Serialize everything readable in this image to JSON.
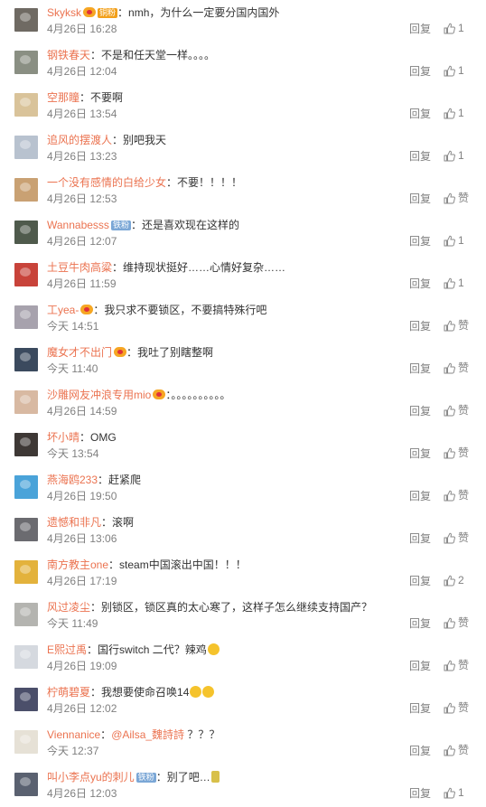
{
  "reply_label": "回复",
  "comments": [
    {
      "avatar_color": "#6f6a63",
      "name": "Skyksk",
      "badge": "",
      "vip": true,
      "medal": "铜粉",
      "colon": "：",
      "mention": "",
      "text": "nmh，为什么一定要分国内国外",
      "emoji": "",
      "time": "4月26日 16:28",
      "like": "1"
    },
    {
      "avatar_color": "#8a8f83",
      "name": "钢铁春天",
      "badge": "",
      "vip": false,
      "medal": "",
      "colon": "：",
      "mention": "",
      "text": "不是和任天堂一样。。。。",
      "emoji": "",
      "time": "4月26日 12:04",
      "like": "1"
    },
    {
      "avatar_color": "#d9c39a",
      "name": "空那瞳",
      "badge": "",
      "vip": false,
      "medal": "",
      "colon": "：",
      "mention": "",
      "text": "不要啊",
      "emoji": "",
      "time": "4月26日 13:54",
      "like": "1"
    },
    {
      "avatar_color": "#b8c2cf",
      "name": "追风的摆渡人",
      "badge": "",
      "vip": false,
      "medal": "",
      "colon": "：",
      "mention": "",
      "text": "别吧我天",
      "emoji": "",
      "time": "4月26日 13:23",
      "like": "1"
    },
    {
      "avatar_color": "#c9a173",
      "name": "一个没有感情的白给少女",
      "badge": "",
      "vip": false,
      "medal": "",
      "colon": "：",
      "mention": "",
      "text": "不要！！！！",
      "emoji": "",
      "time": "4月26日 12:53",
      "like": "赞"
    },
    {
      "avatar_color": "#4f5a4c",
      "name": "Wannabesss",
      "badge": "铁粉",
      "vip": false,
      "medal": "",
      "colon": "：",
      "mention": "",
      "text": "还是喜欢现在这样的",
      "emoji": "",
      "time": "4月26日 12:07",
      "like": "1"
    },
    {
      "avatar_color": "#c8433a",
      "name": "土豆牛肉高粱",
      "badge": "",
      "vip": false,
      "medal": "",
      "colon": "：",
      "mention": "",
      "text": "维持现状挺好……心情好复杂……",
      "emoji": "",
      "time": "4月26日 11:59",
      "like": "1"
    },
    {
      "avatar_color": "#a7a2ad",
      "name": "工yea-",
      "badge": "",
      "vip": true,
      "medal": "",
      "colon": "：",
      "mention": "",
      "text": "我只求不要锁区，不要搞特殊行吧",
      "emoji": "",
      "time": "今天 14:51",
      "like": "赞"
    },
    {
      "avatar_color": "#3b4a5e",
      "name": "魔女才不出门",
      "badge": "",
      "vip": true,
      "medal": "",
      "colon": "：",
      "mention": "",
      "text": "我吐了别瞎整啊",
      "emoji": "",
      "time": "今天 11:40",
      "like": "赞"
    },
    {
      "avatar_color": "#d8b9a2",
      "name": "沙雕网友冲浪专用mio",
      "badge": "",
      "vip": true,
      "medal": "",
      "colon": "：",
      "mention": "",
      "text": "。。。。。。。。。。",
      "emoji": "",
      "time": "4月26日 14:59",
      "like": "赞"
    },
    {
      "avatar_color": "#3e3835",
      "name": "坏小晴",
      "badge": "",
      "vip": false,
      "medal": "",
      "colon": "：",
      "mention": "",
      "text": "OMG",
      "emoji": "",
      "time": "今天 13:54",
      "like": "赞"
    },
    {
      "avatar_color": "#4aa3d9",
      "name": "燕海鸥233",
      "badge": "",
      "vip": false,
      "medal": "",
      "colon": "：",
      "mention": "",
      "text": "赶紧爬",
      "emoji": "",
      "time": "4月26日 19:50",
      "like": "赞"
    },
    {
      "avatar_color": "#6b6b70",
      "name": "遗憾和非凡",
      "badge": "",
      "vip": false,
      "medal": "",
      "colon": "：",
      "mention": "",
      "text": "滚啊",
      "emoji": "",
      "time": "4月26日 13:06",
      "like": "赞"
    },
    {
      "avatar_color": "#e3b23c",
      "name": "南方教主one",
      "badge": "",
      "vip": false,
      "medal": "",
      "colon": "：",
      "mention": "",
      "text": "steam中国滚出中国！！！",
      "emoji": "",
      "time": "4月26日 17:19",
      "like": "2"
    },
    {
      "avatar_color": "#b4b4b0",
      "name": "风过凌尘",
      "badge": "",
      "vip": false,
      "medal": "",
      "colon": "：",
      "mention": "",
      "text": "别锁区，锁区真的太心寒了，这样子怎么继续支持国产？",
      "emoji": "",
      "time": "今天 11:49",
      "like": "赞"
    },
    {
      "avatar_color": "#d5d9df",
      "name": "E熙过禹",
      "badge": "",
      "vip": false,
      "medal": "",
      "colon": "：",
      "mention": "",
      "text": "国行switch 二代？辣鸡",
      "emoji": "smile",
      "time": "4月26日 19:09",
      "like": "赞"
    },
    {
      "avatar_color": "#4b4f6a",
      "name": "柠萌碧夏",
      "badge": "",
      "vip": false,
      "medal": "",
      "colon": "：",
      "mention": "",
      "text": "我想要使命召唤14",
      "emoji": "cry-cry",
      "time": "4月26日 12:02",
      "like": "赞"
    },
    {
      "avatar_color": "#e6e1d6",
      "name": "Viennanice",
      "badge": "",
      "vip": false,
      "medal": "",
      "colon": "：",
      "mention": "@Ailsa_魏詩詩",
      "text": " ？？？",
      "emoji": "",
      "time": "今天 12:37",
      "like": "赞"
    },
    {
      "avatar_color": "#5a6170",
      "name": "叫小李点yu的刺儿",
      "badge": "铁粉",
      "vip": false,
      "medal": "",
      "colon": "：",
      "mention": "",
      "text": "别了吧…",
      "emoji": "vial",
      "time": "4月26日 12:03",
      "like": "1"
    }
  ]
}
